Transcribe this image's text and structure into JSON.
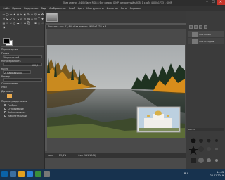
{
  "titlebar": {
    "title": "[Без имени] -24.0 (Цвет RGB 8 бит гамма, GIMP встроенный sRGB, 1 слой) 4600x1733 – GIMP",
    "minimize": "–",
    "maximize": "☐",
    "close": "✕"
  },
  "menubar": {
    "items": [
      "Файл",
      "Правка",
      "Выделение",
      "Вид",
      "Изображение",
      "Слой",
      "Цвет",
      "Инструменты",
      "Фильтры",
      "Окна",
      "Справка"
    ]
  },
  "toolbox": {
    "tool_icons": [
      "rect-select-icon",
      "ellipse-select-icon",
      "free-select-icon",
      "fuzzy-select-icon",
      "color-select-icon",
      "scissors-icon",
      "foreground-select-icon",
      "paths-icon",
      "color-picker-icon",
      "zoom-icon",
      "measure-icon",
      "move-icon",
      "align-icon",
      "crop-icon",
      "unified-transform-icon",
      "rotate-icon",
      "scale-icon",
      "shear-icon",
      "perspective-icon",
      "flip-icon",
      "cage-icon",
      "warp-icon",
      "text-icon",
      "bucket-fill-icon",
      "gradient-icon",
      "pencil-icon",
      "paintbrush-icon",
      "eraser-icon",
      "airbrush-icon",
      "ink-icon",
      "mypaint-icon",
      "clone-icon",
      "heal-icon",
      "perspective-clone-icon",
      "blur-icon",
      "smudge-icon",
      "dodge-burn-icon"
    ],
    "options_title": "Перемещение",
    "mode_label": "Режим",
    "mode_value": "Нормальный",
    "opacity_label": "Непрозрачность",
    "opacity_value": "100,0",
    "brush_label": "Кисть",
    "brush_value": "2. Hardness 050",
    "size_label": "Размер",
    "aspect_label": "Соотношение",
    "angle_label": "Угол",
    "dynamics_label": "Динамика",
    "dynamics_options_label": "Параметры динамики",
    "jitter_label": "Разброс",
    "smooth_label": "Сглаживание",
    "lock_label": "Заблокировать",
    "incremental_label": "Накопительный",
    "fg_color": "#000000",
    "bg_color": "#ffffff",
    "chip_color": "#e9a94e"
  },
  "document": {
    "info_text": "Показать все: 23,4% «Без имени» 4600×1733 ⊕ 4"
  },
  "status": {
    "text": "Фон (111,1 МБ)",
    "unit": "пикс",
    "zoom": "23,4%"
  },
  "dock": {
    "layers": [
      {
        "label": "Фон копия"
      },
      {
        "label": "Фон исходник"
      }
    ],
    "brushes_title": "Кисти",
    "brush_name": "2. Hardness 050"
  },
  "taskbar": {
    "time": "14:53",
    "date": "26.01.2019",
    "lang": "RU"
  }
}
